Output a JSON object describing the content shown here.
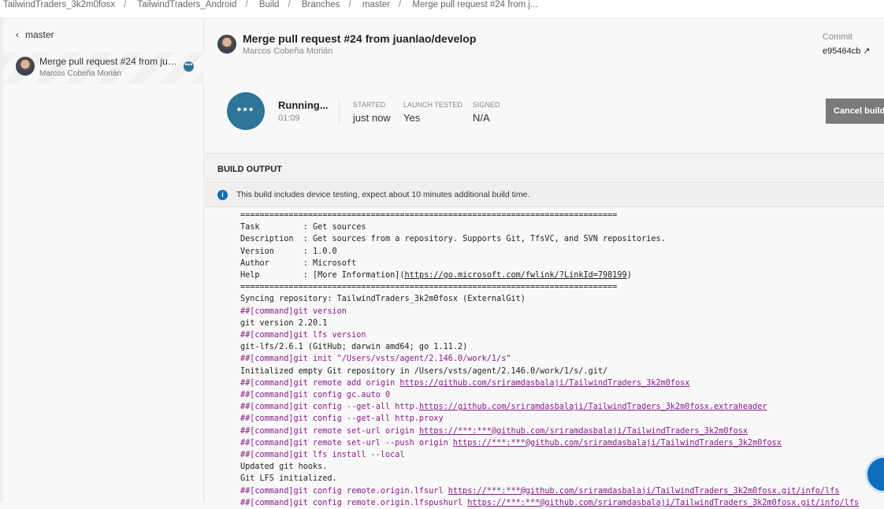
{
  "breadcrumb": [
    "TailwindTraders_3k2m0fosx",
    "TailwindTraders_Android",
    "Build",
    "Branches",
    "master",
    "Merge pull request #24 from j..."
  ],
  "sidebar": {
    "back_label": "master",
    "build": {
      "title": "Merge pull request #24 from juanlao/develop",
      "author": "Marcos Cobeña Morián",
      "status_icon": "ellipsis"
    }
  },
  "header": {
    "title": "Merge pull request #24 from juanlao/develop",
    "author": "Marcos Cobeña Morián",
    "commit_label": "Commit",
    "commit_hash": "e95464cb"
  },
  "status": {
    "state": "Running...",
    "elapsed": "01:09",
    "started_label": "STARTED",
    "started": "just now",
    "launch_label": "LAUNCH TESTED",
    "launch": "Yes",
    "signed_label": "SIGNED",
    "signed": "N/A",
    "cancel_label": "Cancel build"
  },
  "output": {
    "title": "BUILD OUTPUT",
    "info": "This build includes device testing, expect about 10 minutes additional build time.",
    "lines": [
      {
        "cmd": false,
        "text": "==============================================================================",
        "link": "",
        "after": ""
      },
      {
        "cmd": false,
        "text": "Task         : Get sources",
        "link": "",
        "after": ""
      },
      {
        "cmd": false,
        "text": "Description  : Get sources from a repository. Supports Git, TfsVC, and SVN repositories.",
        "link": "",
        "after": ""
      },
      {
        "cmd": false,
        "text": "Version      : 1.0.0",
        "link": "",
        "after": ""
      },
      {
        "cmd": false,
        "text": "Author       : Microsoft",
        "link": "",
        "after": ""
      },
      {
        "cmd": false,
        "text": "Help         : [More Information](",
        "link": "https://go.microsoft.com/fwlink/?LinkId=798199",
        "after": ")"
      },
      {
        "cmd": false,
        "text": "==============================================================================",
        "link": "",
        "after": ""
      },
      {
        "cmd": false,
        "text": "Syncing repository: TailwindTraders_3k2m0fosx (ExternalGit)",
        "link": "",
        "after": ""
      },
      {
        "cmd": true,
        "text": "##[command]git version",
        "link": "",
        "after": ""
      },
      {
        "cmd": false,
        "text": "git version 2.20.1",
        "link": "",
        "after": ""
      },
      {
        "cmd": true,
        "text": "##[command]git lfs version",
        "link": "",
        "after": ""
      },
      {
        "cmd": false,
        "text": "git-lfs/2.6.1 (GitHub; darwin amd64; go 1.11.2)",
        "link": "",
        "after": ""
      },
      {
        "cmd": true,
        "text": "##[command]git init \"/Users/vsts/agent/2.146.0/work/1/s\"",
        "link": "",
        "after": ""
      },
      {
        "cmd": false,
        "text": "Initialized empty Git repository in /Users/vsts/agent/2.146.0/work/1/s/.git/",
        "link": "",
        "after": ""
      },
      {
        "cmd": true,
        "text": "##[command]git remote add origin ",
        "link": "https://github.com/sriramdasbalaji/TailwindTraders_3k2m0fosx",
        "after": ""
      },
      {
        "cmd": true,
        "text": "##[command]git config gc.auto 0",
        "link": "",
        "after": ""
      },
      {
        "cmd": true,
        "text": "##[command]git config --get-all http.",
        "link": "https://github.com/sriramdasbalaji/TailwindTraders_3k2m0fosx.extraheader",
        "after": ""
      },
      {
        "cmd": true,
        "text": "##[command]git config --get-all http.proxy",
        "link": "",
        "after": ""
      },
      {
        "cmd": true,
        "text": "##[command]git remote set-url origin ",
        "link": "https://***:***@github.com/sriramdasbalaji/TailwindTraders_3k2m0fosx",
        "after": ""
      },
      {
        "cmd": true,
        "text": "##[command]git remote set-url --push origin ",
        "link": "https://***:***@github.com/sriramdasbalaji/TailwindTraders_3k2m0fosx",
        "after": ""
      },
      {
        "cmd": true,
        "text": "##[command]git lfs install --local",
        "link": "",
        "after": ""
      },
      {
        "cmd": false,
        "text": "Updated git hooks.",
        "link": "",
        "after": ""
      },
      {
        "cmd": false,
        "text": "Git LFS initialized.",
        "link": "",
        "after": ""
      },
      {
        "cmd": true,
        "text": "##[command]git config remote.origin.lfsurl ",
        "link": "https://***:***@github.com/sriramdasbalaji/TailwindTraders_3k2m0fosx.git/info/lfs",
        "after": ""
      },
      {
        "cmd": true,
        "text": "##[command]git config remote.origin.lfspushurl ",
        "link": "https://***:***@github.com/sriramdasbalaji/TailwindTraders_3k2m0fosx.git/info/lfs",
        "after": ""
      }
    ]
  }
}
